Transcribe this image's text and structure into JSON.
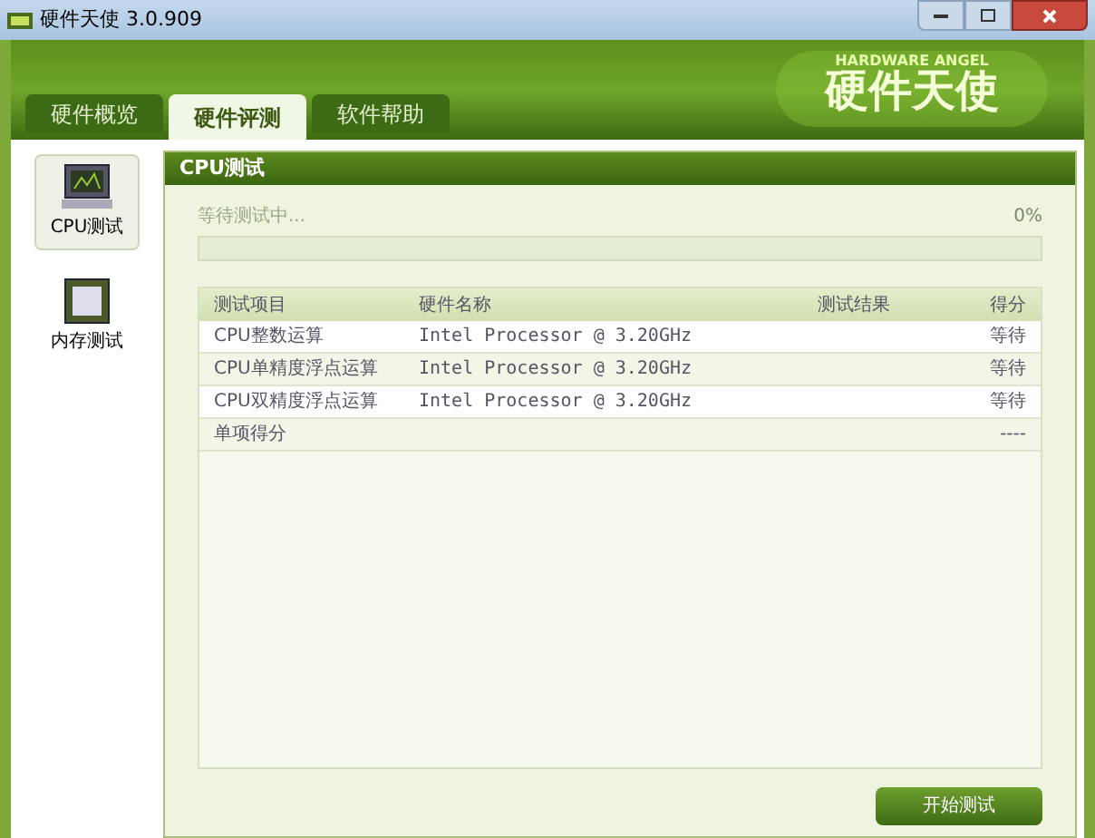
{
  "window": {
    "title": "硬件天使 3.0.909"
  },
  "logo": {
    "subtitle": "HARDWARE ANGEL",
    "title": "硬件天使"
  },
  "tabs": [
    {
      "label": "硬件概览",
      "selected": false
    },
    {
      "label": "硬件评测",
      "selected": true
    },
    {
      "label": "软件帮助",
      "selected": false
    }
  ],
  "sidebar": {
    "items": [
      {
        "label": "CPU测试",
        "kind": "cpu",
        "selected": true
      },
      {
        "label": "内存测试",
        "kind": "memory",
        "selected": false
      }
    ]
  },
  "panel": {
    "title": "CPU测试",
    "status": "等待测试中...",
    "percent": "0%",
    "progress": {
      "level": 0
    }
  },
  "table": {
    "columns": [
      "测试项目",
      "硬件名称",
      "测试结果",
      "得分"
    ],
    "rows": [
      [
        "CPU整数运算",
        "Intel Processor @ 3.20GHz",
        "",
        "等待"
      ],
      [
        "CPU单精度浮点运算",
        "Intel Processor @ 3.20GHz",
        "",
        "等待"
      ],
      [
        "CPU双精度浮点运算",
        "Intel Processor @ 3.20GHz",
        "",
        "等待"
      ],
      [
        "单项得分",
        "",
        "",
        "----"
      ]
    ]
  },
  "buttons": [
    "开始测试"
  ]
}
